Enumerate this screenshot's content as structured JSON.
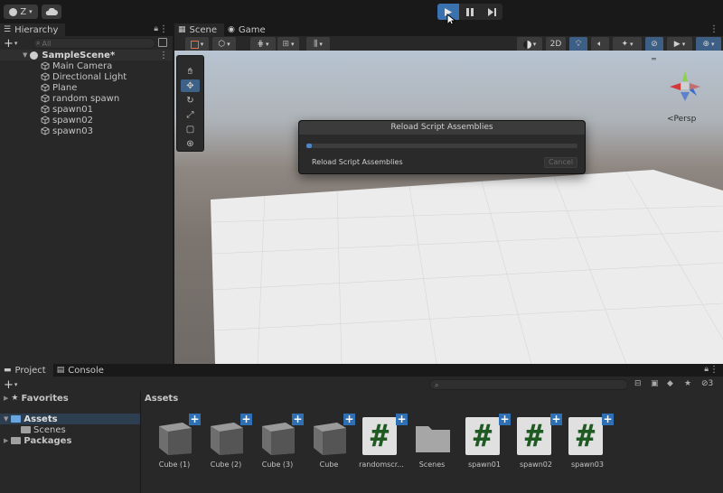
{
  "toolbar": {
    "account_label": "Z",
    "play_state": "playing"
  },
  "hierarchy": {
    "tab_label": "Hierarchy",
    "search_placeholder": "All",
    "scene_name": "SampleScene*",
    "items": [
      {
        "label": "Main Camera"
      },
      {
        "label": "Directional Light"
      },
      {
        "label": "Plane"
      },
      {
        "label": "random spawn"
      },
      {
        "label": "spawn01"
      },
      {
        "label": "spawn02"
      },
      {
        "label": "spawn03"
      }
    ]
  },
  "scene": {
    "tabs": [
      {
        "label": "Scene",
        "active": true
      },
      {
        "label": "Game",
        "active": false
      }
    ],
    "mode_2d_label": "2D",
    "projection_label": "<Persp"
  },
  "dialog": {
    "title": "Reload Script Assemblies",
    "message": "Reload Script Assemblies",
    "cancel_label": "Cancel",
    "progress": 0.02
  },
  "project": {
    "tabs": [
      {
        "label": "Project",
        "active": true
      },
      {
        "label": "Console",
        "active": false
      }
    ],
    "hidden_count": "3",
    "tree": {
      "favorites_label": "Favorites",
      "assets_label": "Assets",
      "scenes_label": "Scenes",
      "packages_label": "Packages"
    },
    "breadcrumb": "Assets",
    "assets": [
      {
        "label": "Cube (1)",
        "kind": "prefab"
      },
      {
        "label": "Cube (2)",
        "kind": "prefab"
      },
      {
        "label": "Cube (3)",
        "kind": "prefab"
      },
      {
        "label": "Cube",
        "kind": "prefab"
      },
      {
        "label": "randomscr...",
        "kind": "script"
      },
      {
        "label": "Scenes",
        "kind": "folder"
      },
      {
        "label": "spawn01",
        "kind": "script"
      },
      {
        "label": "spawn02",
        "kind": "script"
      },
      {
        "label": "spawn03",
        "kind": "script"
      }
    ]
  },
  "colors": {
    "accent": "#3a72b0",
    "script_hash": "#1f5a22",
    "progress": "#4b86c8"
  }
}
